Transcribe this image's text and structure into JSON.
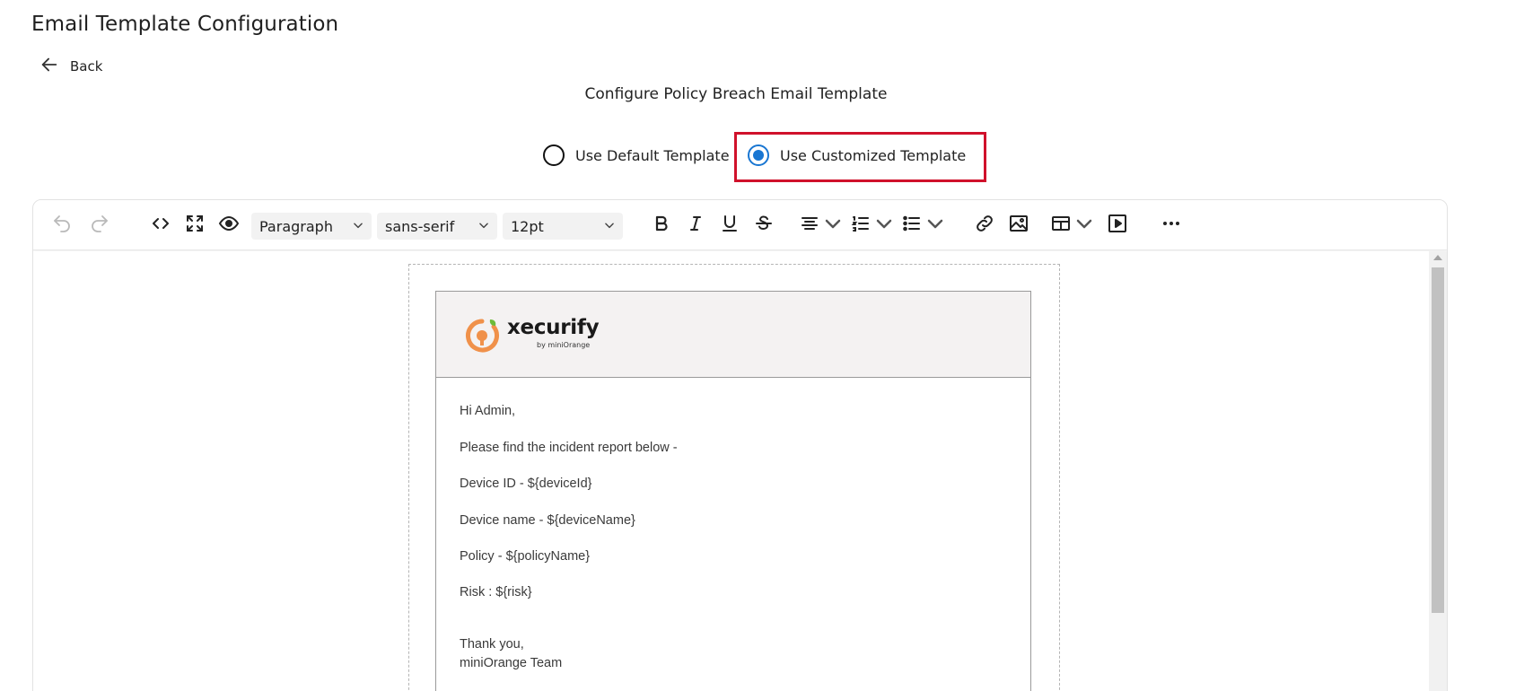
{
  "page": {
    "title": "Email Template Configuration",
    "back_label": "Back",
    "subtitle": "Configure Policy Breach Email Template"
  },
  "template_choice": {
    "options": [
      {
        "label": "Use Default Template",
        "selected": false
      },
      {
        "label": "Use Customized Template",
        "selected": true
      }
    ],
    "highlight_color": "#d0112b",
    "radio_accent": "#1976d2"
  },
  "toolbar": {
    "block_format": "Paragraph",
    "font_family": "sans-serif",
    "font_size": "12pt",
    "icons": [
      "undo-icon",
      "redo-icon",
      "source-code-icon",
      "fullscreen-icon",
      "preview-icon",
      "bold-icon",
      "italic-icon",
      "underline-icon",
      "strikethrough-icon",
      "align-icon",
      "numbered-list-icon",
      "bullet-list-icon",
      "link-icon",
      "image-icon",
      "table-icon",
      "media-icon",
      "more-icon"
    ]
  },
  "email": {
    "logo": {
      "word": "xecurify",
      "by": "by miniOrange"
    },
    "greeting": "Hi Admin,",
    "intro": "Please find the incident report below -",
    "device_id": "Device ID - ${deviceId}",
    "device_name": "Device name - ${deviceName}",
    "policy": "Policy - ${policyName}",
    "risk": "Risk : ${risk}",
    "closing": "Thank you,",
    "signature": "miniOrange Team"
  }
}
